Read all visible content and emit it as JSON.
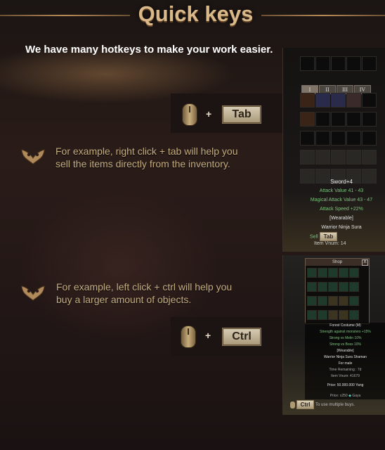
{
  "header": {
    "title": "Quick keys"
  },
  "intro_text": "We have many hotkeys to make your work easier.",
  "hotkeys": [
    {
      "modifier": "+",
      "key": "Tab"
    },
    {
      "modifier": "+",
      "key": "Ctrl"
    }
  ],
  "tips": [
    {
      "line1": "For example, right click + tab will help you",
      "line2": "sell the items directly from the inventory."
    },
    {
      "line1": "For example, left click + ctrl will help you",
      "line2": "buy a larger amount of objects."
    }
  ],
  "inventory_screenshot": {
    "tabs": [
      "I",
      "II",
      "III",
      "IV"
    ],
    "tooltip": {
      "name": "Sword+4",
      "lines": [
        "Attack Value 41 - 43",
        "Magical Attack Value 43 - 47",
        "Attack Speed +22%"
      ],
      "wearable": "[Wearable]",
      "classes": "Warrior Ninja Sura",
      "sell_label": "Sell",
      "sell_key": "Tab",
      "item_vnum": "Item Vnum: 14"
    }
  },
  "shop_screenshot": {
    "title": "Shop",
    "close": "X",
    "tooltip": {
      "name": "Forest Costume (M)",
      "lines": [
        "Strength against monsters +15%",
        "Strong vs Melin 10%",
        "Strong vs Boss 10%"
      ],
      "wearable": "[Wearable]",
      "classes": "Warrior Ninja Sura Shaman",
      "gender": "For male",
      "time_remaining": "Time Remaining : 7d",
      "item_vnum": "Item Vnum: 41679",
      "price": "Price: 50.000.000 Yang",
      "price_alt": "Price: x250",
      "currency": "Gaya",
      "footer_key": "Ctrl",
      "footer_text": "To use multiple buys."
    }
  },
  "colors": {
    "title": "#d9b88a",
    "tip_text": "#c5ad82",
    "intro": "#ffffff"
  },
  "icons": [
    "mouse-icon",
    "tip-emblem-icon"
  ]
}
